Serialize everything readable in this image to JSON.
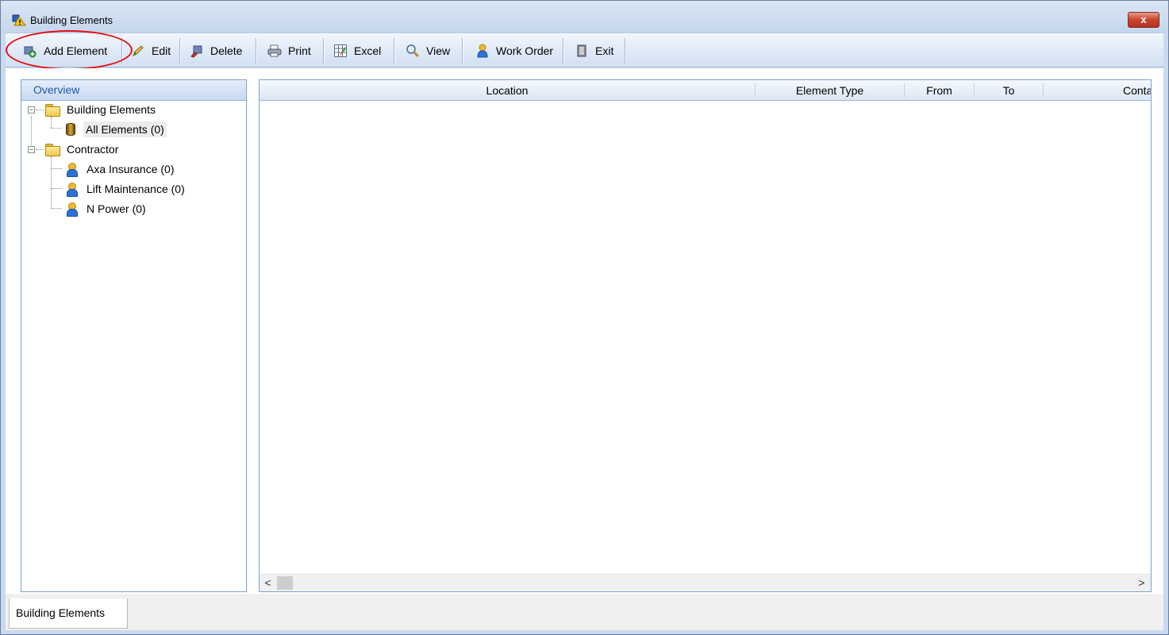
{
  "window": {
    "title": "Building Elements",
    "close_label": "x"
  },
  "toolbar": {
    "buttons": [
      {
        "label": "Add Element",
        "icon": "add-element-icon"
      },
      {
        "label": "Edit",
        "icon": "edit-pencil-icon"
      },
      {
        "label": "Delete",
        "icon": "delete-icon"
      },
      {
        "label": "Print",
        "icon": "printer-icon"
      },
      {
        "label": "Excel",
        "icon": "excel-icon"
      },
      {
        "label": "View",
        "icon": "magnifier-icon"
      },
      {
        "label": "Work Order",
        "icon": "person-icon"
      },
      {
        "label": "Exit",
        "icon": "exit-door-icon"
      }
    ]
  },
  "tree": {
    "header": "Overview",
    "nodes": [
      {
        "label": "Building Elements",
        "icon": "folder-icon",
        "expander": "−"
      },
      {
        "label": "All Elements (0)",
        "icon": "database-icon",
        "selected": true
      },
      {
        "label": "Contractor",
        "icon": "folder-icon",
        "expander": "−"
      },
      {
        "label": "Axa Insurance (0)",
        "icon": "person-icon"
      },
      {
        "label": "Lift Maintenance (0)",
        "icon": "person-icon"
      },
      {
        "label": "N Power (0)",
        "icon": "person-icon"
      }
    ]
  },
  "grid": {
    "columns": [
      "Location",
      "Element Type",
      "From",
      "To",
      "Conta"
    ],
    "rows": [],
    "scroll_left": "<",
    "scroll_right": ">"
  },
  "tabs": [
    {
      "label": "Building Elements",
      "active": true
    }
  ],
  "colors": {
    "highlight": "#e01010",
    "tree_header_text": "#1d58a8",
    "window_frame": "#c9daf0"
  }
}
